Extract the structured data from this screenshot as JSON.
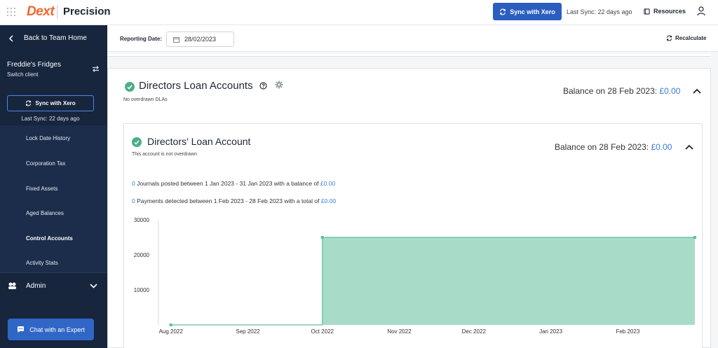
{
  "top": {
    "logo": "Dext",
    "product": "Precision",
    "sync_button": "Sync with Xero",
    "last_sync": "Last Sync: 22 days ago",
    "resources": "Resources"
  },
  "sidebar": {
    "back": "Back to Team Home",
    "client_name": "Freddie's Fridges",
    "switch_client": "Switch client",
    "sync_button": "Sync with Xero",
    "last_sync": "Last Sync: 22 days ago",
    "items": [
      {
        "label": "Lock Date History",
        "active": false
      },
      {
        "label": "Corporation Tax",
        "active": false
      },
      {
        "label": "Fixed Assets",
        "active": false
      },
      {
        "label": "Aged Balances",
        "active": false
      },
      {
        "label": "Control Accounts",
        "active": true
      },
      {
        "label": "Activity Stats",
        "active": false
      }
    ],
    "admin": "Admin",
    "chat": "Chat with an Expert"
  },
  "main": {
    "date_label": "Reporting Date:",
    "date_value": "28/02/2023",
    "recalculate": "Recalculate",
    "section": {
      "title": "Directors Loan Accounts",
      "subtitle": "No overdrawn DLAs",
      "balance_label": "Balance on 28 Feb 2023: ",
      "balance_value": "£0.00"
    },
    "account": {
      "title": "Directors' Loan Account",
      "subtitle": "This account is not overdrawn",
      "balance_label": "Balance on 28 Feb 2023: ",
      "balance_value": "£0.00",
      "journals_count": "0",
      "journals_text": " Journals posted between 1 Jan 2023 - 31 Jan 2023 with a balance of ",
      "journals_amount": "£0.00",
      "payments_count": "0",
      "payments_text": " Payments detected between 1 Feb 2023 - 28 Feb 2023 with a total of ",
      "payments_amount": "£0.00"
    }
  },
  "colors": {
    "brand": "#f2662d",
    "primary": "#2b5fbf",
    "sidebar": "#17253d",
    "success": "#4caf87",
    "link": "#3b7bd6",
    "area_fill": "#a8dcc9",
    "area_line": "#5fbf98"
  },
  "chart_data": {
    "type": "area",
    "x": [
      "2022-08-01",
      "2022-10-01",
      "2022-10-01",
      "2023-02-28"
    ],
    "values": [
      0,
      0,
      25000,
      25000
    ],
    "x_ticks": [
      "Aug 2022",
      "Sep 2022",
      "Oct 2022",
      "Nov 2022",
      "Dec 2022",
      "Jan 2023",
      "Feb 2023"
    ],
    "y_ticks": [
      "10000",
      "20000",
      "30000"
    ],
    "ylim": [
      0,
      30000
    ],
    "grid": false
  }
}
